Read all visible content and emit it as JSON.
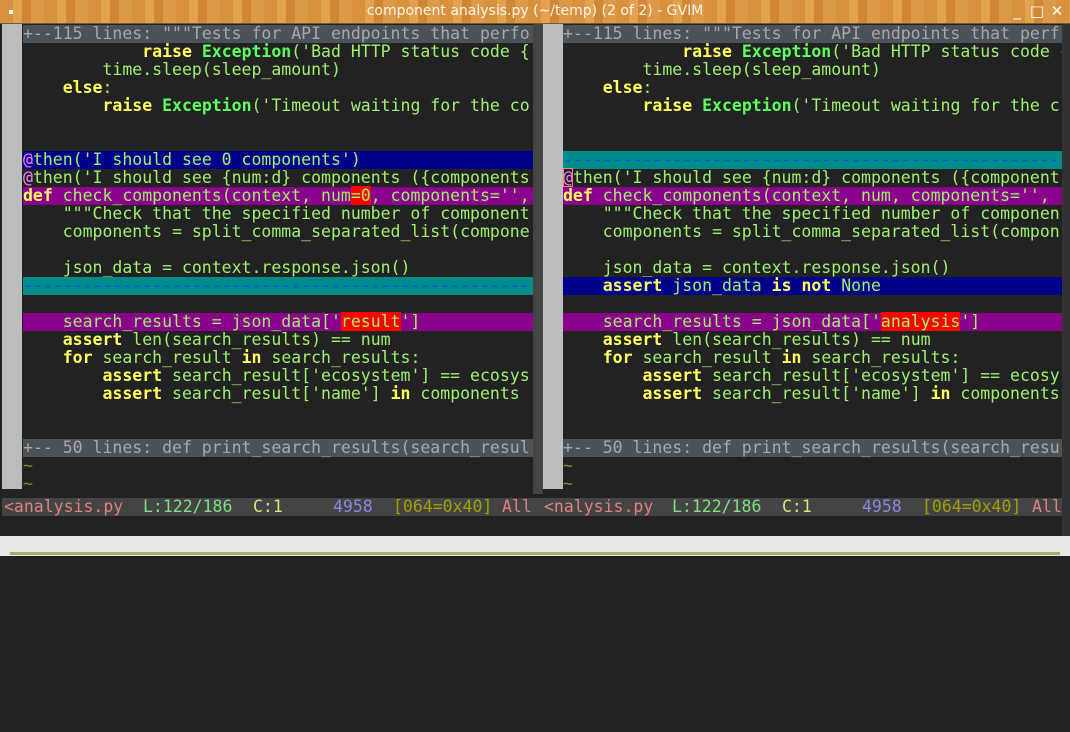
{
  "window": {
    "title": "component analysis.py (~/temp) (2 of 2) - GVIM",
    "buttons": {
      "minimize": "_",
      "maximize": "□",
      "close": "✕"
    }
  },
  "colors": {
    "keyword": "#ffff60",
    "string": "#a0f070",
    "diff_change": "#8b008b",
    "diff_add": "#00008b",
    "diff_delete": "#008b8b",
    "diff_text": "#ff0000"
  },
  "panes": [
    {
      "lines": [
        {
          "bg": "fold",
          "mark": "+",
          "segs": [
            [
              "+--115 lines: \"\"\"Tests for API endpoints that perfo",
              ""
            ]
          ]
        },
        {
          "segs": [
            [
              "            ",
              ""
            ],
            [
              "raise",
              "k"
            ],
            [
              " ",
              ""
            ],
            [
              "Exception",
              "e"
            ],
            [
              "('Bad HTTP status code {",
              ""
            ]
          ]
        },
        {
          "segs": [
            [
              "        time.sleep(sleep_amount)",
              ""
            ]
          ]
        },
        {
          "segs": [
            [
              "    ",
              ""
            ],
            [
              "else",
              "k"
            ],
            [
              ":",
              ""
            ]
          ]
        },
        {
          "segs": [
            [
              "        ",
              ""
            ],
            [
              "raise",
              "k"
            ],
            [
              " ",
              ""
            ],
            [
              "Exception",
              "e"
            ],
            [
              "('Timeout waiting for the co",
              ""
            ]
          ]
        },
        {
          "segs": []
        },
        {
          "segs": []
        },
        {
          "bg": "blue",
          "segs": [
            [
              "@",
              "d"
            ],
            [
              "then('I should see 0 components')",
              ""
            ]
          ]
        },
        {
          "segs": [
            [
              "@",
              "d"
            ],
            [
              "then('I should see {num:d} components ({components",
              ""
            ]
          ]
        },
        {
          "bg": "purple",
          "segs": [
            [
              "def",
              "k"
            ],
            [
              " check_components(context, num",
              ""
            ],
            [
              "=0",
              "r"
            ],
            [
              ", components='',",
              ""
            ]
          ]
        },
        {
          "segs": [
            [
              "    \"\"\"Check that the specified number of component",
              ""
            ]
          ]
        },
        {
          "segs": [
            [
              "    components = split_comma_separated_list(compone",
              ""
            ]
          ]
        },
        {
          "segs": []
        },
        {
          "segs": [
            [
              "    json_data = context.response.json()",
              ""
            ]
          ]
        },
        {
          "bg": "filler",
          "segs": [
            [
              "---------------------------------------------------",
              ""
            ]
          ]
        },
        {
          "segs": []
        },
        {
          "bg": "purple",
          "segs": [
            [
              "    search_results = json_data['",
              ""
            ],
            [
              "result",
              "r"
            ],
            [
              "']",
              ""
            ]
          ]
        },
        {
          "segs": [
            [
              "    ",
              ""
            ],
            [
              "assert",
              "k"
            ],
            [
              " len(search_results) == num",
              ""
            ]
          ]
        },
        {
          "segs": [
            [
              "    ",
              ""
            ],
            [
              "for",
              "k"
            ],
            [
              " search_result ",
              ""
            ],
            [
              "in",
              "k"
            ],
            [
              " search_results:",
              ""
            ]
          ]
        },
        {
          "segs": [
            [
              "        ",
              ""
            ],
            [
              "assert",
              "k"
            ],
            [
              " search_result['ecosystem'] == ecosys",
              ""
            ]
          ]
        },
        {
          "segs": [
            [
              "        ",
              ""
            ],
            [
              "assert",
              "k"
            ],
            [
              " search_result['name'] ",
              ""
            ],
            [
              "in",
              "k"
            ],
            [
              " components",
              ""
            ]
          ]
        },
        {
          "segs": []
        },
        {
          "segs": []
        },
        {
          "bg": "fold",
          "mark": "+",
          "segs": [
            [
              "+-- 50 lines: def print_search_results(search_resul",
              ""
            ]
          ]
        },
        {
          "segs": [
            [
              "~",
              "t"
            ]
          ]
        },
        {
          "segs": [
            [
              "~",
              "t"
            ]
          ]
        }
      ],
      "status": {
        "file": "<analysis.py",
        "line": "L:122/186",
        "col": "C:1",
        "bytes": "4958",
        "char": "[064=0x40]",
        "pos": "All"
      }
    },
    {
      "lines": [
        {
          "bg": "fold",
          "mark": "+",
          "segs": [
            [
              "+--115 lines: \"\"\"Tests for API endpoints that perf",
              ""
            ]
          ]
        },
        {
          "segs": [
            [
              "            ",
              ""
            ],
            [
              "raise",
              "k"
            ],
            [
              " ",
              ""
            ],
            [
              "Exception",
              "e"
            ],
            [
              "('Bad HTTP status code {",
              ""
            ]
          ]
        },
        {
          "segs": [
            [
              "        time.sleep(sleep_amount)",
              ""
            ]
          ]
        },
        {
          "segs": [
            [
              "    ",
              ""
            ],
            [
              "else",
              "k"
            ],
            [
              ":",
              ""
            ]
          ]
        },
        {
          "segs": [
            [
              "        ",
              ""
            ],
            [
              "raise",
              "k"
            ],
            [
              " ",
              ""
            ],
            [
              "Exception",
              "e"
            ],
            [
              "('Timeout waiting for the c",
              ""
            ]
          ]
        },
        {
          "segs": []
        },
        {
          "segs": []
        },
        {
          "bg": "filler",
          "segs": [
            [
              "--------------------------------------------------",
              ""
            ]
          ]
        },
        {
          "segs": [
            [
              "@",
              "d cur"
            ],
            [
              "then('I should see {num:d} components ({component",
              ""
            ]
          ]
        },
        {
          "bg": "purple",
          "segs": [
            [
              "def",
              "k"
            ],
            [
              " check_components(context, num, components='', ",
              ""
            ]
          ]
        },
        {
          "segs": [
            [
              "    \"\"\"Check that the specified number of componen",
              ""
            ]
          ]
        },
        {
          "segs": [
            [
              "    components = split_comma_separated_list(compon",
              ""
            ]
          ]
        },
        {
          "segs": []
        },
        {
          "segs": [
            [
              "    json_data = context.response.json()",
              ""
            ]
          ]
        },
        {
          "bg": "blue",
          "segs": [
            [
              "    ",
              ""
            ],
            [
              "assert",
              "k"
            ],
            [
              " json_data ",
              ""
            ],
            [
              "is",
              "k"
            ],
            [
              " ",
              ""
            ],
            [
              "not",
              "k"
            ],
            [
              " None",
              ""
            ]
          ]
        },
        {
          "segs": []
        },
        {
          "bg": "purple",
          "segs": [
            [
              "    search_results = json_data['",
              ""
            ],
            [
              "analysis",
              "r"
            ],
            [
              "']",
              ""
            ]
          ]
        },
        {
          "segs": [
            [
              "    ",
              ""
            ],
            [
              "assert",
              "k"
            ],
            [
              " len(search_results) == num",
              ""
            ]
          ]
        },
        {
          "segs": [
            [
              "    ",
              ""
            ],
            [
              "for",
              "k"
            ],
            [
              " search_result ",
              ""
            ],
            [
              "in",
              "k"
            ],
            [
              " search_results:",
              ""
            ]
          ]
        },
        {
          "segs": [
            [
              "        ",
              ""
            ],
            [
              "assert",
              "k"
            ],
            [
              " search_result['ecosystem'] == ecosy",
              ""
            ]
          ]
        },
        {
          "segs": [
            [
              "        ",
              ""
            ],
            [
              "assert",
              "k"
            ],
            [
              " search_result['name'] ",
              ""
            ],
            [
              "in",
              "k"
            ],
            [
              " components",
              ""
            ]
          ]
        },
        {
          "segs": []
        },
        {
          "segs": []
        },
        {
          "bg": "fold",
          "mark": "+",
          "segs": [
            [
              "+-- 50 lines: def print_search_results(search_resu",
              ""
            ]
          ]
        },
        {
          "segs": [
            [
              "~",
              "t"
            ]
          ]
        },
        {
          "segs": [
            [
              "~",
              "t"
            ]
          ]
        }
      ],
      "status": {
        "file": "<nalysis.py",
        "line": "L:122/186",
        "col": "C:1",
        "bytes": "4958",
        "char": "[064=0x40]",
        "pos": "All"
      }
    }
  ]
}
